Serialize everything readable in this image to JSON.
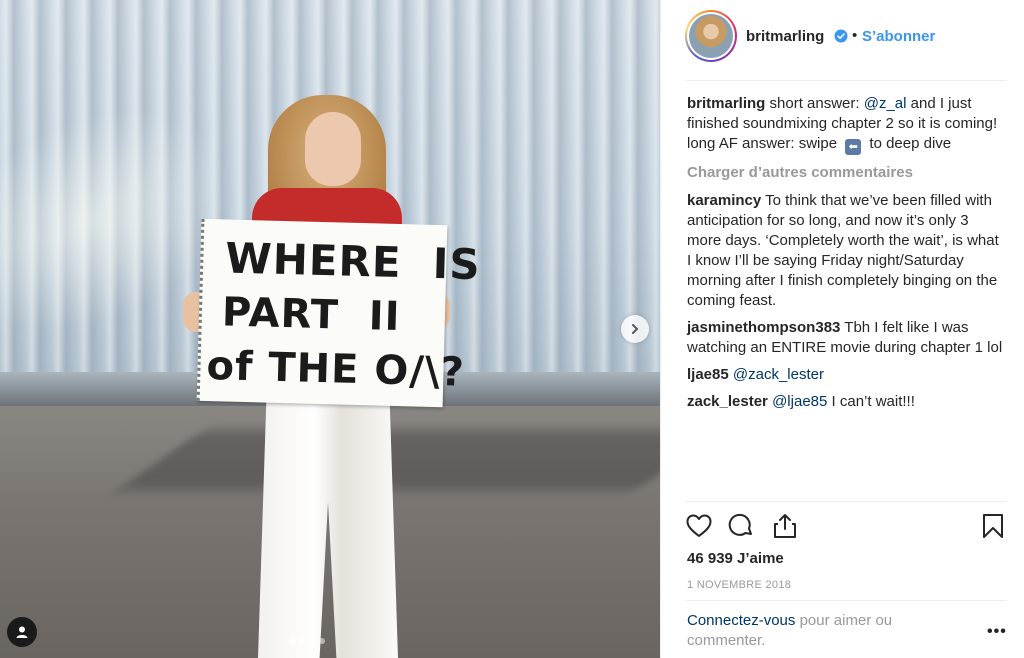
{
  "media": {
    "sign_lines": [
      "WHERE  IS",
      "PART  II",
      "of THE O/\\?"
    ],
    "carousel_total": 4,
    "carousel_active": 1
  },
  "header": {
    "username": "britmarling",
    "separator": "•",
    "follow_label": "S’abonner"
  },
  "caption": {
    "user": "britmarling",
    "text_before": " short answer: ",
    "mention": "@z_al",
    "text_after": " and I just finished soundmixing chapter 2 so it is coming!",
    "line2_before": "long AF answer: swipe ",
    "swipe_icon": "⬅",
    "line2_after": " to deep dive"
  },
  "load_more_label": "Charger d’autres commentaires",
  "comments": [
    {
      "user": "karamincy",
      "text": " To think that we’ve been filled with anticipation for so long, and now it’s only 3 more days. ‘Completely worth the wait’, is what I know I’ll be saying Friday night/Saturday morning after I finish completely binging on the coming feast.",
      "mention": "",
      "after": ""
    },
    {
      "user": "jasminethompson383",
      "text": " Tbh I felt like I was watching an ENTIRE movie during chapter 1 lol",
      "mention": "",
      "after": ""
    },
    {
      "user": "ljae85",
      "text": " ",
      "mention": "@zack_lester",
      "after": ""
    },
    {
      "user": "zack_lester",
      "text": " ",
      "mention": "@ljae85",
      "after": " I can’t wait!!!"
    }
  ],
  "likes": "46 939 J’aime",
  "date": "1 NOVEMBRE 2018",
  "login": {
    "link": "Connectez-vous",
    "rest": " pour aimer ou commenter."
  },
  "more_label": "•••",
  "icons": {
    "like": "heart-icon",
    "comment": "comment-icon",
    "share": "share-icon",
    "save": "bookmark-icon",
    "next": "chevron-right-icon",
    "tag": "user-tag-icon",
    "verified": "verified-badge-icon"
  },
  "colors": {
    "link_blue": "#3897f0",
    "mention_blue": "#003569",
    "muted": "#999999"
  }
}
